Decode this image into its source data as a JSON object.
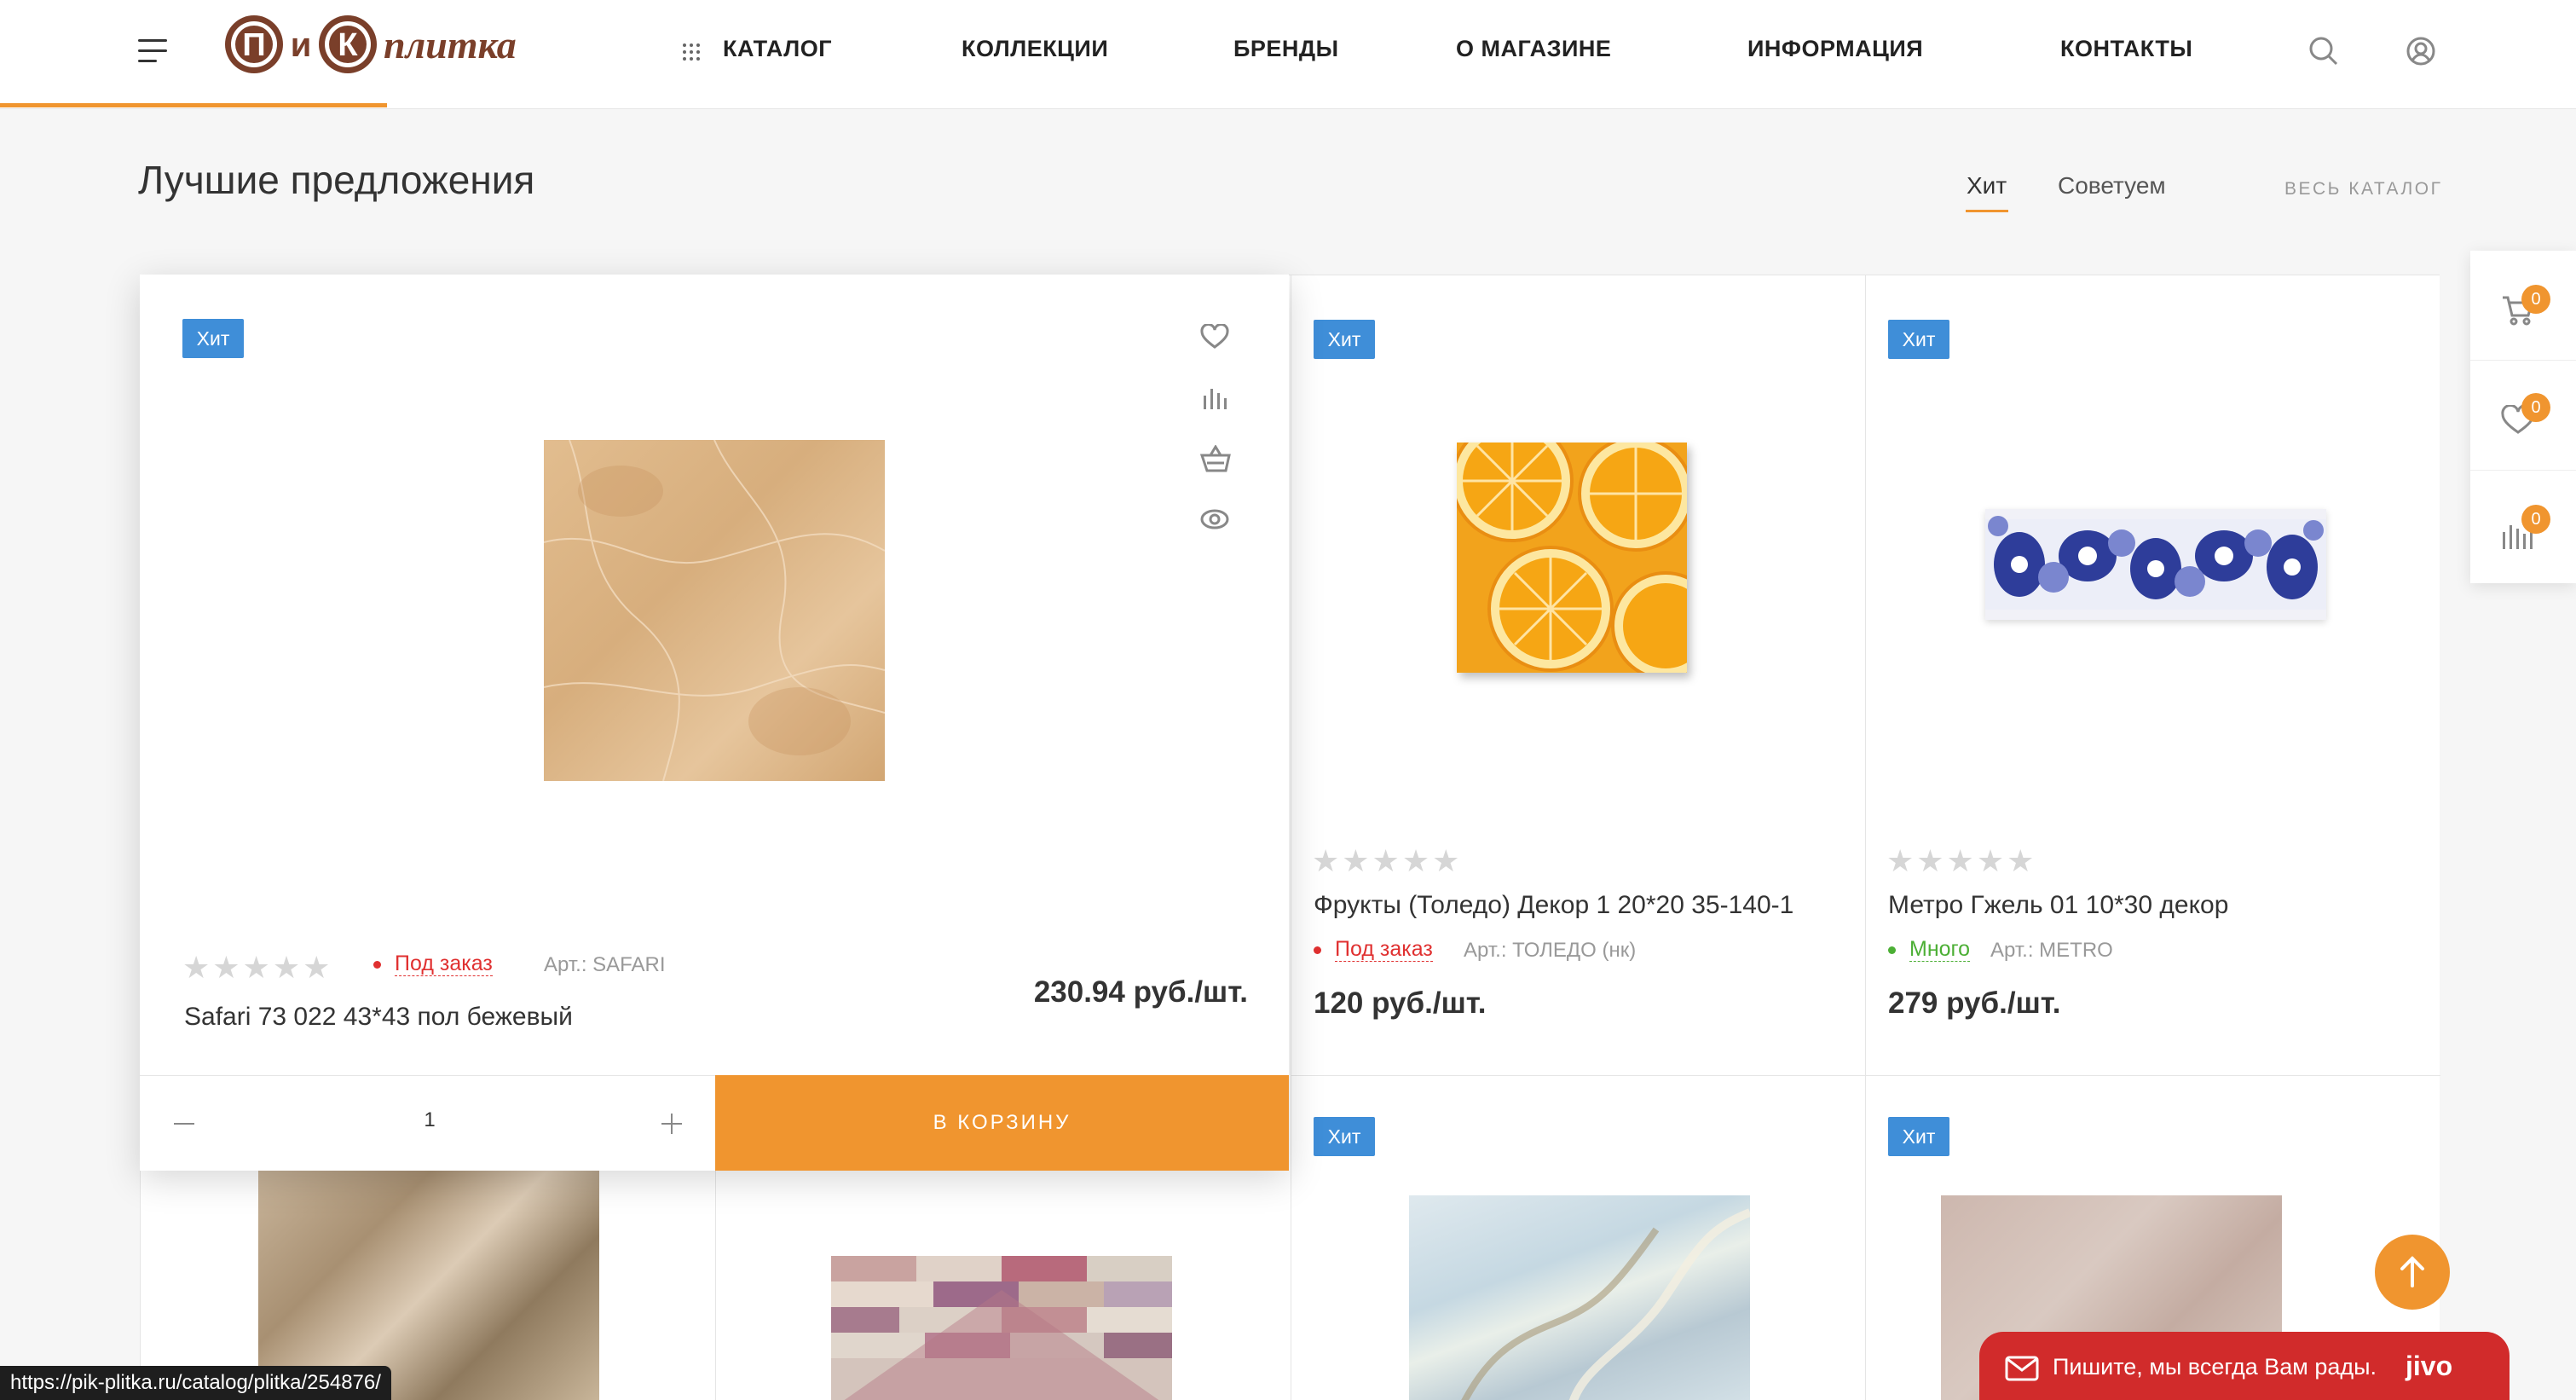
{
  "header": {
    "logo": {
      "part1": "П",
      "part2": "и",
      "part3": "К",
      "part4": "плитка"
    },
    "nav": [
      {
        "label": "КАТАЛОГ"
      },
      {
        "label": "КОЛЛЕКЦИИ"
      },
      {
        "label": "БРЕНДЫ"
      },
      {
        "label": "О МАГАЗИНЕ"
      },
      {
        "label": "ИНФОРМАЦИЯ"
      },
      {
        "label": "КОНТАКТЫ"
      }
    ],
    "icons": [
      "menu-icon",
      "grid-dots-icon",
      "search-icon",
      "user-icon"
    ]
  },
  "section": {
    "title": "Лучшие предложения",
    "tabs": [
      {
        "label": "Хит",
        "active": true
      },
      {
        "label": "Советуем",
        "active": false
      }
    ],
    "all_catalog": "ВЕСЬ КАТАЛОГ"
  },
  "products": [
    {
      "badge": "Хит",
      "stars": "★★★★★",
      "status": "Под заказ",
      "status_color": "#e03030",
      "article": "Арт.: SAFARI",
      "name": "Safari 73 022 43*43 пол бежевый",
      "price": "230.94 руб./шт.",
      "quantity": "1",
      "cart_label": "В КОРЗИНУ"
    },
    {
      "badge": "Хит",
      "stars": "★★★★★",
      "status": "Под заказ",
      "status_color": "#e03030",
      "article": "Арт.: ТОЛЕДО (нк)",
      "name": "Фрукты (Толедо) Декор 1 20*20 35-140-1",
      "price": "120 руб./шт."
    },
    {
      "badge": "Хит",
      "stars": "★★★★★",
      "status": "Много",
      "status_color": "#4caf35",
      "article": "Арт.: METRO",
      "name": "Метро Гжель 01 10*30 декор",
      "price": "279 руб./шт."
    },
    {
      "badge": "Хит"
    },
    {
      "badge": "Хит"
    }
  ],
  "right_panel": {
    "cart_count": "0",
    "favorites_count": "0",
    "compare_count": "0"
  },
  "jivo": {
    "text": "Пишите, мы всегда Вам рады.",
    "brand": "jivo"
  },
  "status_bar": {
    "url": "https://pik-plitka.ru/catalog/plitka/254876/"
  },
  "colors": {
    "accent": "#f0952f",
    "badge": "#3f8ed8",
    "jivo": "#d12b2b"
  }
}
